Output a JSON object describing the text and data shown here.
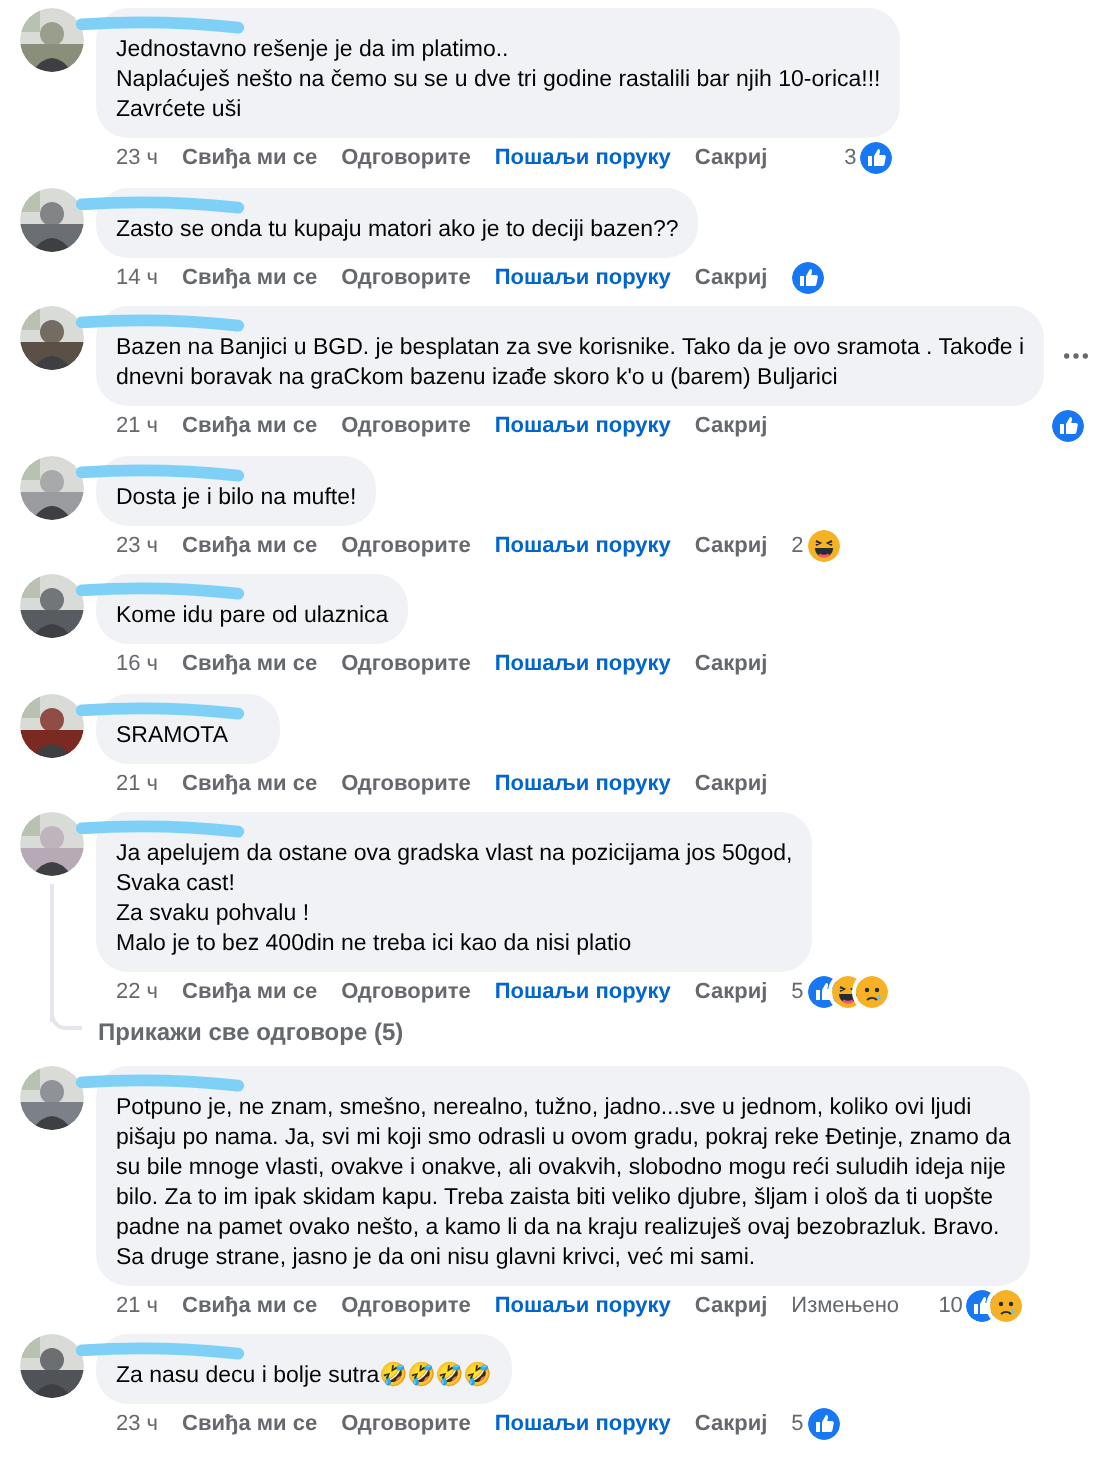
{
  "comments": [
    {
      "text": "Jednostavno rešenje je da im platimo..\nNaplaćuješ nešto na čemo su se u dve tri godine rastalili bar njih 10-orica!!!\nZavrćete uši",
      "time": "23 ч",
      "like": "Свиђа ми се",
      "reply": "Одговорите",
      "message": "Пошаљи поруку",
      "hide": "Сакриј",
      "count": "3",
      "reactions": [
        {
          "kind": "like"
        }
      ]
    },
    {
      "text": "Zasto se onda tu kupaju matori ako je to deciji bazen??",
      "time": "14 ч",
      "like": "Свиђа ми се",
      "reply": "Одговорите",
      "message": "Пошаљи поруку",
      "hide": "Сакриј",
      "reactions": [
        {
          "kind": "like"
        }
      ]
    },
    {
      "text": "Bazen na Banjici u BGD. je besplatan za sve korisnike. Tako da je ovo sramota . Takođe i\ndnevni boravak na graCkom bazenu izađe skoro k'o u (barem) Buljarici",
      "time": "21 ч",
      "like": "Свиђа ми се",
      "reply": "Одговорите",
      "message": "Пошаљи поруку",
      "hide": "Сакриј",
      "reactions": [
        {
          "kind": "like"
        }
      ],
      "more": true
    },
    {
      "text": "Dosta je i bilo na mufte!",
      "time": "23 ч",
      "like": "Свиђа ми се",
      "reply": "Одговорите",
      "message": "Пошаљи поруку",
      "hide": "Сакриј",
      "count": "2",
      "reactions": [
        {
          "kind": "haha"
        }
      ]
    },
    {
      "text": "Kome idu pare od ulaznica",
      "time": "16 ч",
      "like": "Свиђа ми се",
      "reply": "Одговорите",
      "message": "Пошаљи поруку",
      "hide": "Сакриј"
    },
    {
      "text": "SRAMOTA",
      "time": "21 ч",
      "like": "Свиђа ми се",
      "reply": "Одговорите",
      "message": "Пошаљи поруку",
      "hide": "Сакриј"
    },
    {
      "text": "Ja apelujem da ostane ova gradska vlast na pozicijama jos 50god,\nSvaka cast!\nZa svaku pohvalu !\nMalo je to bez 400din ne treba ici kao da nisi platio",
      "time": "22 ч",
      "like": "Свиђа ми се",
      "reply": "Одговорите",
      "message": "Пошаљи поруку",
      "hide": "Сакриј",
      "count": "5",
      "reactions": [
        {
          "kind": "like"
        },
        {
          "kind": "haha"
        },
        {
          "kind": "sad"
        }
      ],
      "thread": true,
      "show_replies": "Прикажи све одговоре (5)"
    },
    {
      "text": "Potpuno je, ne znam, smešno, nerealno, tužno, jadno...sve u jednom, koliko ovi ljudi\npišaju po nama. Ja, svi mi koji smo odrasli u ovom gradu, pokraj reke Đetinje, znamo da\nsu bile mnoge vlasti, ovakve i onakve, ali ovakvih, slobodno mogu reći suludih ideja nije\nbilo. Za to im ipak skidam kapu. Treba zaista biti veliko djubre, šljam i ološ da ti uopšte\npadne na pamet ovako nešto, a kamo li da na kraju realizuješ ovaj bezobrazluk. Bravo.\nSa druge strane, jasno je da oni nisu glavni krivci, već mi sami.",
      "time": "21 ч",
      "like": "Свиђа ми се",
      "reply": "Одговорите",
      "message": "Пошаљи поруку",
      "hide": "Сакриј",
      "edited": "Измењено",
      "count": "10",
      "reactions": [
        {
          "kind": "like"
        },
        {
          "kind": "sad"
        }
      ]
    },
    {
      "text": "Za nasu decu i bolje sutra🤣🤣🤣🤣",
      "time": "23 ч",
      "like": "Свиђа ми се",
      "reply": "Одговорите",
      "message": "Пошаљи поруку",
      "hide": "Сакриј",
      "count": "5",
      "reactions": [
        {
          "kind": "like"
        }
      ]
    }
  ]
}
